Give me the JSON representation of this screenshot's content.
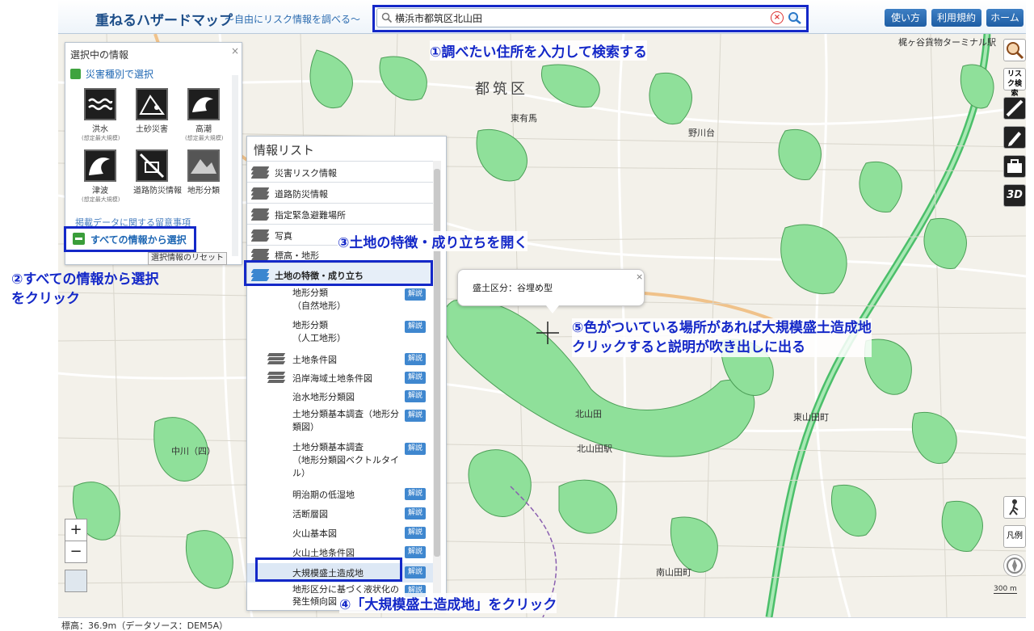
{
  "header": {
    "title": "重ねるハザードマップ",
    "subtitle": "～自由にリスク情報を調べる～",
    "search_value": "横浜市都筑区北山田",
    "buttons": [
      "使い方",
      "利用規約",
      "ホーム"
    ]
  },
  "left_panel": {
    "title": "選択中の情報",
    "switch_label": "災害種別で選択",
    "hazards": [
      {
        "label": "洪水",
        "note": "(想定最大規模)",
        "icon": "flood-icon"
      },
      {
        "label": "土砂災害",
        "note": "",
        "icon": "landslide-icon"
      },
      {
        "label": "高潮",
        "note": "(想定最大規模)",
        "icon": "storm-surge-icon"
      },
      {
        "label": "津波",
        "note": "(想定最大規模)",
        "icon": "tsunami-icon"
      },
      {
        "label": "道路防災情報",
        "note": "",
        "icon": "road-icon"
      },
      {
        "label": "地形分類",
        "note": "",
        "icon": "terrain-icon"
      }
    ],
    "notice": "掲載データに関する留意事項",
    "all_info_button": "すべての情報から選択",
    "reset_button": "選択情報のリセット"
  },
  "info_list": {
    "title": "情報リスト",
    "categories": [
      "災害リスク情報",
      "道路防災情報",
      "指定緊急避難場所",
      "写真",
      "標高・地形",
      "土地の特徴・成り立ち"
    ],
    "sub_items": [
      {
        "label": "地形分類\n（自然地形）",
        "has_kaisetsu": true
      },
      {
        "label": "地形分類\n（人工地形）",
        "has_kaisetsu": true
      },
      {
        "label": "土地条件図",
        "has_kaisetsu": true
      },
      {
        "label": "沿岸海域土地条件図",
        "has_kaisetsu": true
      },
      {
        "label": "治水地形分類図",
        "has_kaisetsu": true
      },
      {
        "label": "土地分類基本調査（地形分\n類図）",
        "has_kaisetsu": true
      },
      {
        "label": "土地分類基本調査\n（地形分類図ベクトルタイ\nル）",
        "has_kaisetsu": true
      },
      {
        "label": "明治期の低湿地",
        "has_kaisetsu": true
      },
      {
        "label": "活断層図",
        "has_kaisetsu": true
      },
      {
        "label": "火山基本図",
        "has_kaisetsu": true
      },
      {
        "label": "火山土地条件図",
        "has_kaisetsu": true
      },
      {
        "label": "大規模盛土造成地",
        "has_kaisetsu": true
      },
      {
        "label": "地形区分に基づく液状化の\n発生傾向図",
        "has_kaisetsu": true
      }
    ],
    "kaisetsu_label": "解説"
  },
  "popup": {
    "text": "盛土区分：谷埋め型",
    "close": "×"
  },
  "annotations": {
    "step1": "①調べたい住所を入力して検索する",
    "step2": "②すべての情報から選択\nをクリック",
    "step3": "③土地の特徴・成り立ちを開く",
    "step4": "④「大規模盛土造成地」をクリック",
    "step5": "⑤色がついている場所があれば大規模盛土造成地\nクリックすると説明が吹き出しに出る"
  },
  "map_labels": {
    "ward": "都筑区",
    "place_top_right": "梶ヶ谷貨物ターミナル駅",
    "arima": "東有馬",
    "nomaga": "野川台",
    "yamada": "北山田",
    "higashi_yamada": "東山田町",
    "minami_yamada": "南山田町",
    "station": "北山田駅",
    "nakagawa": "中川（四）",
    "scale": "300 m"
  },
  "right_tools": [
    "search-risk-icon",
    "ruler-icon",
    "pencil-icon",
    "toolbox-icon",
    "3d-icon"
  ],
  "right_tools_label": "リスク検索",
  "legend_label": "凡例",
  "status": "標高：36.9m（データソース：DEM5A）",
  "zoom": {
    "in": "+",
    "out": "−"
  },
  "colors": {
    "annotation": "#1428c8",
    "accent": "#1f5ea4",
    "landfill": "#8fe09a"
  }
}
